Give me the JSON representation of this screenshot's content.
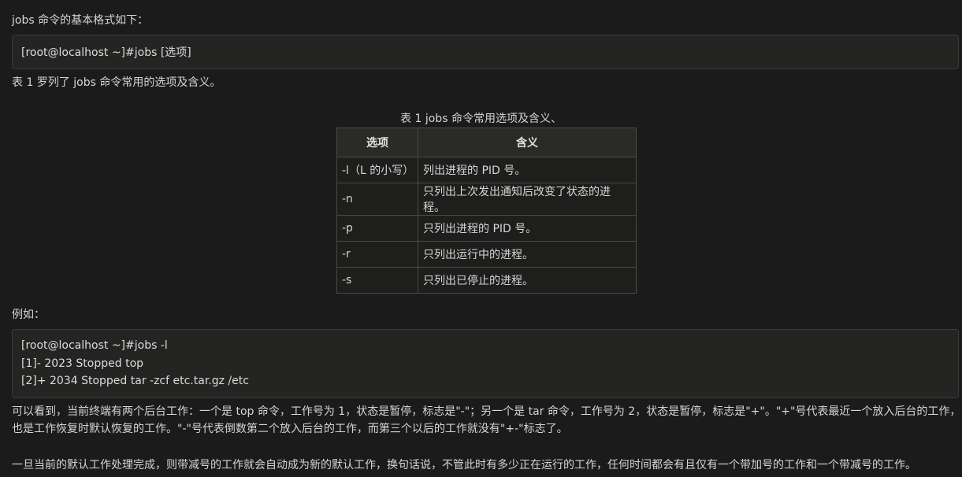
{
  "intro_text": "jobs 命令的基本格式如下：",
  "syntax_code": "[root@localhost ~]#jobs [选项]",
  "table_intro": "表 1 罗列了 jobs 命令常用的选项及含义。",
  "table": {
    "caption": "表 1 jobs 命令常用选项及含义、",
    "headers": [
      "选项",
      "含义"
    ],
    "rows": [
      [
        "-l（L 的小写）",
        "列出进程的 PID 号。"
      ],
      [
        "-n",
        "只列出上次发出通知后改变了状态的进程。"
      ],
      [
        "-p",
        "只列出进程的 PID 号。"
      ],
      [
        "-r",
        "只列出运行中的进程。"
      ],
      [
        "-s",
        "只列出已停止的进程。"
      ]
    ]
  },
  "example_label": "例如：",
  "example_code": [
    "[root@localhost ~]#jobs -l",
    "[1]- 2023 Stopped top",
    "[2]+ 2034 Stopped tar -zcf etc.tar.gz /etc"
  ],
  "explanation": "可以看到，当前终端有两个后台工作：一个是 top 命令，工作号为 1，状态是暂停，标志是\"-\"；另一个是 tar 命令，工作号为 2，状态是暂停，标志是\"+\"。\"+\"号代表最近一个放入后台的工作，也是工作恢复时默认恢复的工作。\"-\"号代表倒数第二个放入后台的工作，而第三个以后的工作就没有\"+-\"标志了。",
  "conclusion": "一旦当前的默认工作处理完成，则带减号的工作就会自动成为新的默认工作，换句话说，不管此时有多少正在运行的工作，任何时间都会有且仅有一个带加号的工作和一个带减号的工作。"
}
